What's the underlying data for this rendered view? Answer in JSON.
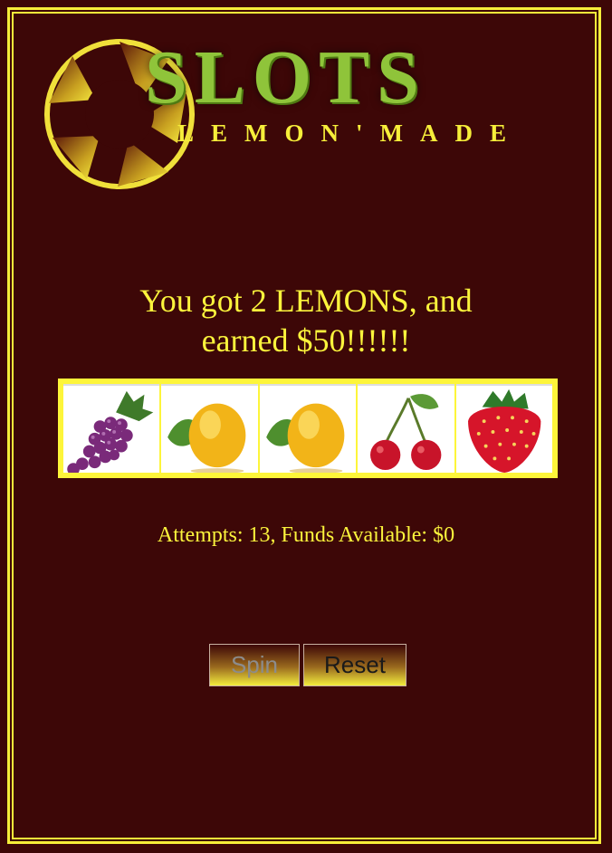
{
  "header": {
    "title": "SLOTS",
    "subtitle": "LEMON'MADE"
  },
  "result": {
    "line1": "You got 2 LEMONS, and",
    "line2": "earned $50!!!!!!"
  },
  "reels": [
    {
      "symbol": "grapes-icon"
    },
    {
      "symbol": "lemon-icon"
    },
    {
      "symbol": "lemon-icon"
    },
    {
      "symbol": "cherries-icon"
    },
    {
      "symbol": "strawberry-icon"
    }
  ],
  "status": {
    "text": "Attempts: 13, Funds Available: $0"
  },
  "controls": {
    "spin_label": "Spin",
    "reset_label": "Reset"
  },
  "colors": {
    "background": "#3d0707",
    "accent_yellow": "#fbf43c",
    "title_green": "#8fc43a"
  }
}
